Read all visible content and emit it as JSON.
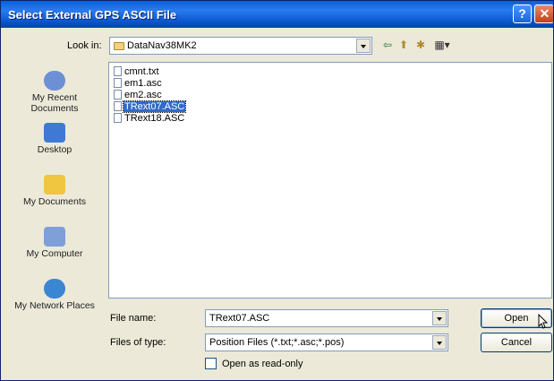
{
  "window": {
    "title": "Select External GPS ASCII File"
  },
  "lookin": {
    "label": "Look in:",
    "value": "DataNav38MK2"
  },
  "toolbar": {
    "back_glyph": "⇦",
    "up_glyph": "⬆",
    "newfolder_glyph": "✱",
    "views_glyph": "▦▾"
  },
  "places": [
    {
      "label": "My Recent Documents",
      "icon": "recent-documents-icon",
      "color": "#6d8fd6"
    },
    {
      "label": "Desktop",
      "icon": "desktop-icon",
      "color": "#3f79d6"
    },
    {
      "label": "My Documents",
      "icon": "my-documents-icon",
      "color": "#f0c640"
    },
    {
      "label": "My Computer",
      "icon": "my-computer-icon",
      "color": "#7e9fd8"
    },
    {
      "label": "My Network Places",
      "icon": "network-places-icon",
      "color": "#3a86d2"
    }
  ],
  "files": [
    {
      "name": "cmnt.txt",
      "selected": false
    },
    {
      "name": "em1.asc",
      "selected": false
    },
    {
      "name": "em2.asc",
      "selected": false
    },
    {
      "name": "TRext07.ASC",
      "selected": true
    },
    {
      "name": "TRext18.ASC",
      "selected": false
    }
  ],
  "filename": {
    "label": "File name:",
    "value": "TRext07.ASC"
  },
  "filetype": {
    "label": "Files of type:",
    "value": "Position Files (*.txt;*.asc;*.pos)"
  },
  "readonly": {
    "label": "Open as read-only",
    "checked": false
  },
  "buttons": {
    "open": "Open",
    "cancel": "Cancel"
  },
  "colors": {
    "title_bar": "#0a5fd8",
    "selection": "#316ac5",
    "dialog_bg": "#ece9d8"
  }
}
